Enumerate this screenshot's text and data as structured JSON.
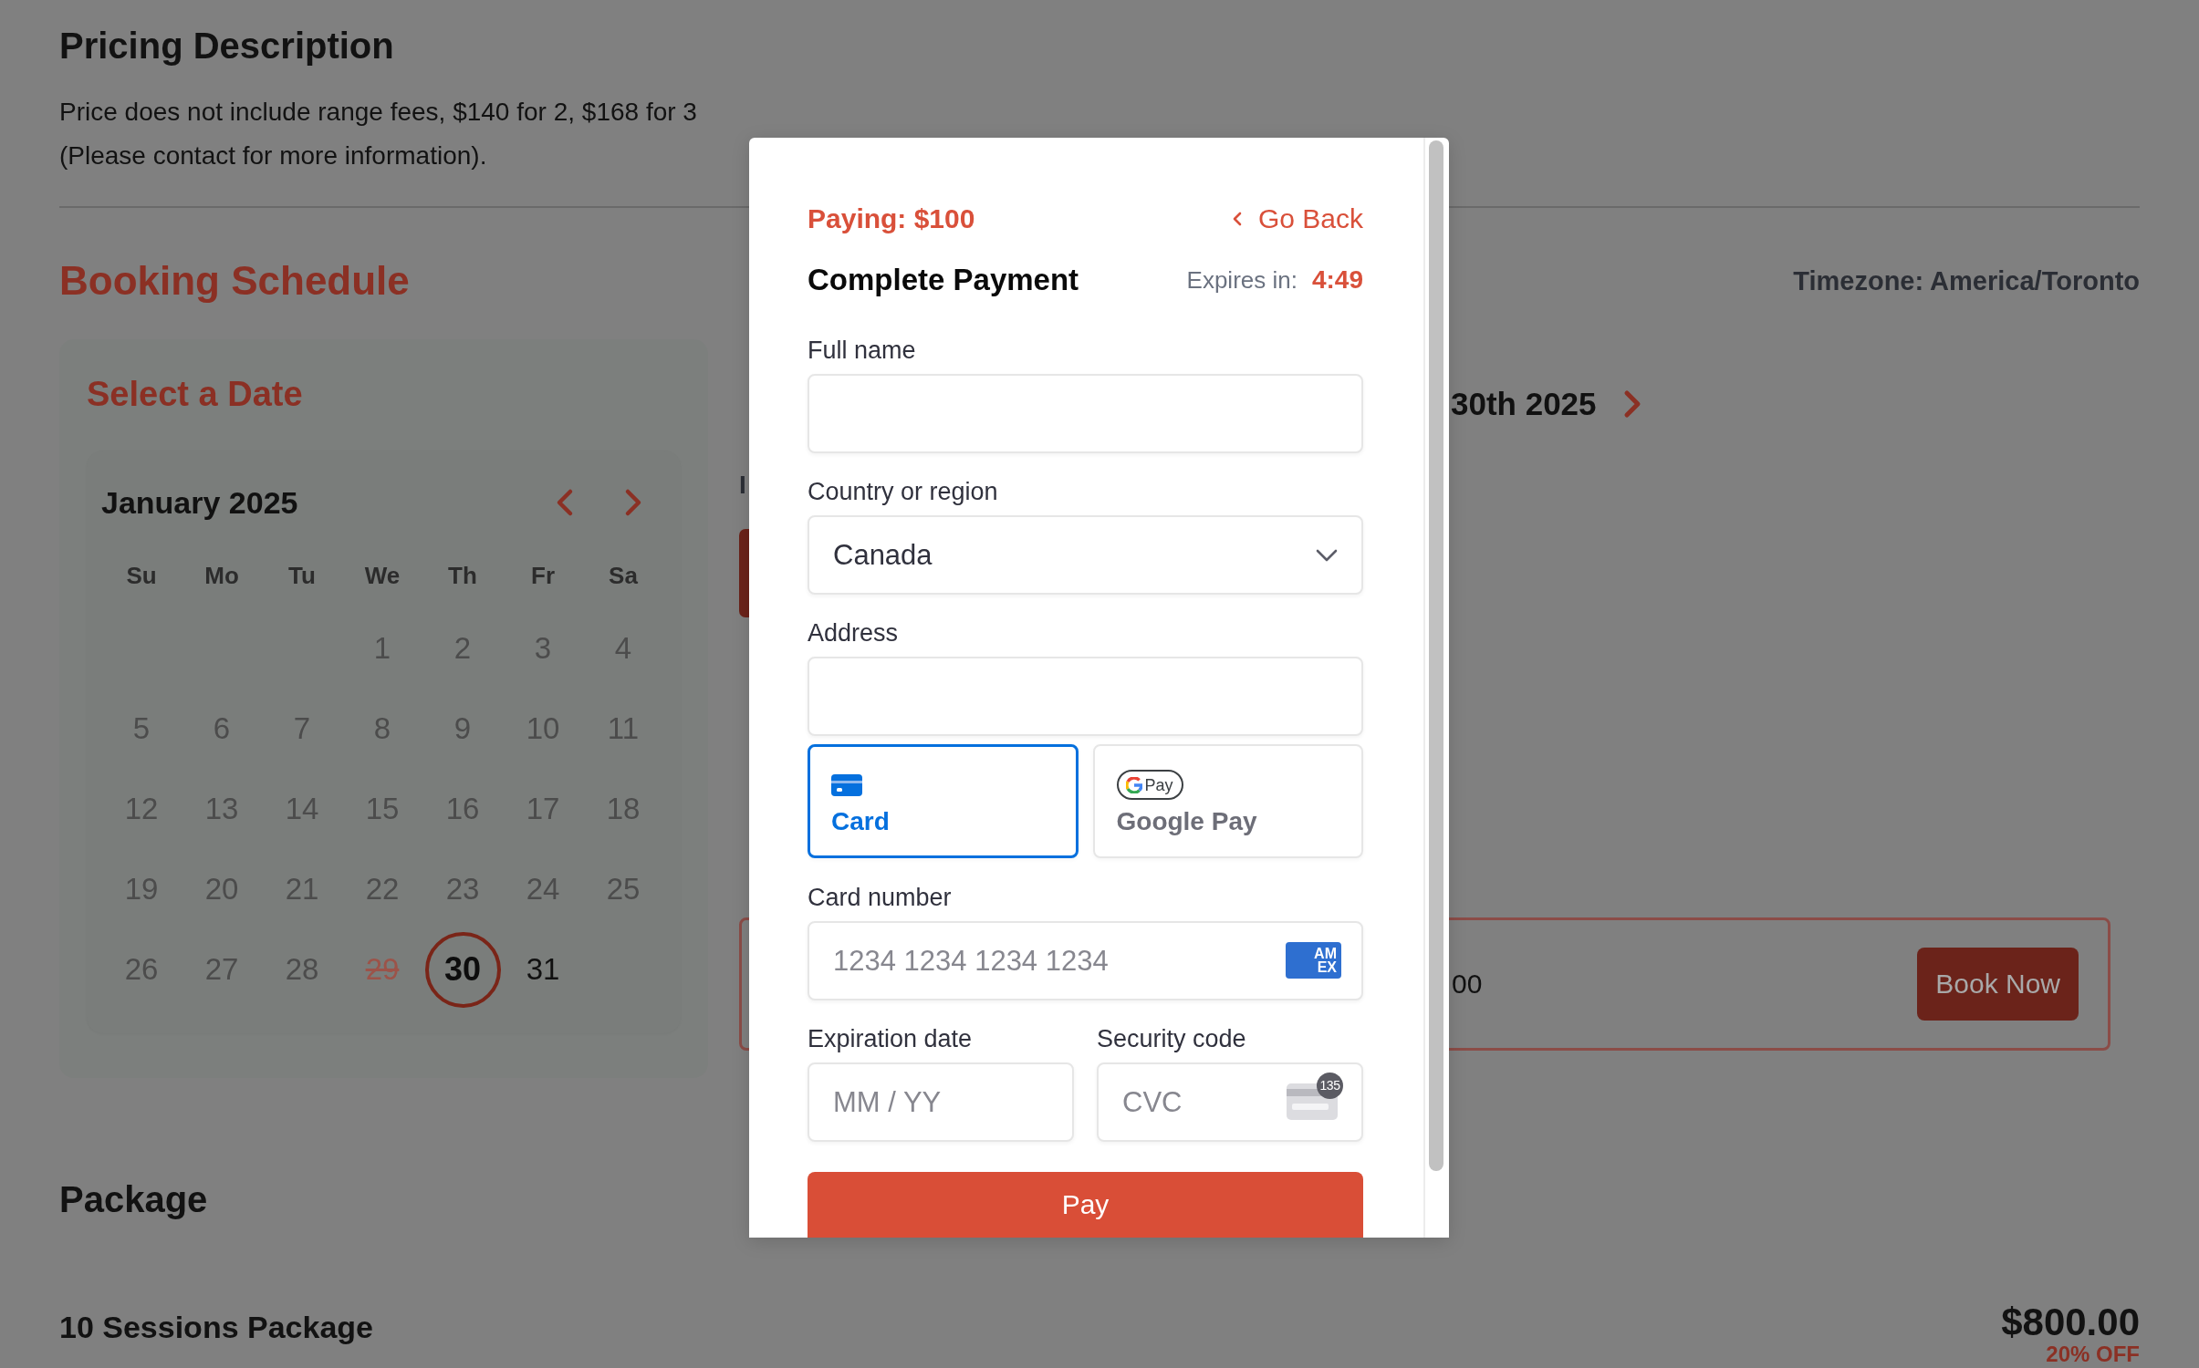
{
  "pricing": {
    "title": "Pricing Description",
    "lines": [
      "Price does not include range fees, $140 for 2, $168 for 3",
      "(Please contact for more information)."
    ]
  },
  "booking": {
    "title": "Booking Schedule",
    "timezone": "Timezone: America/Toronto",
    "date_picker": {
      "title": "Select a Date",
      "month": "January 2025",
      "weekdays": [
        "Su",
        "Mo",
        "Tu",
        "We",
        "Th",
        "Fr",
        "Sa"
      ],
      "weeks": [
        [
          {
            "label": "1",
            "kind": "past",
            "selected": false
          },
          {
            "label": "2",
            "kind": "past",
            "selected": false
          },
          {
            "label": "3",
            "kind": "past",
            "selected": false
          },
          {
            "label": "4",
            "kind": "past",
            "selected": false
          }
        ],
        [
          {
            "label": "5",
            "kind": "past",
            "selected": false
          },
          {
            "label": "6",
            "kind": "past",
            "selected": false
          },
          {
            "label": "7",
            "kind": "past",
            "selected": false
          },
          {
            "label": "8",
            "kind": "past",
            "selected": false
          },
          {
            "label": "9",
            "kind": "past",
            "selected": false
          },
          {
            "label": "10",
            "kind": "past",
            "selected": false
          },
          {
            "label": "11",
            "kind": "past",
            "selected": false
          }
        ],
        [
          {
            "label": "12",
            "kind": "past",
            "selected": false
          },
          {
            "label": "13",
            "kind": "past",
            "selected": false
          },
          {
            "label": "14",
            "kind": "past",
            "selected": false
          },
          {
            "label": "15",
            "kind": "past",
            "selected": false
          },
          {
            "label": "16",
            "kind": "past",
            "selected": false
          },
          {
            "label": "17",
            "kind": "past",
            "selected": false
          },
          {
            "label": "18",
            "kind": "past",
            "selected": false
          }
        ],
        [
          {
            "label": "19",
            "kind": "past",
            "selected": false
          },
          {
            "label": "20",
            "kind": "past",
            "selected": false
          },
          {
            "label": "21",
            "kind": "past",
            "selected": false
          },
          {
            "label": "22",
            "kind": "past",
            "selected": false
          },
          {
            "label": "23",
            "kind": "past",
            "selected": false
          },
          {
            "label": "24",
            "kind": "past",
            "selected": false
          },
          {
            "label": "25",
            "kind": "past",
            "selected": false
          }
        ],
        [
          {
            "label": "26",
            "kind": "past",
            "selected": false
          },
          {
            "label": "27",
            "kind": "past",
            "selected": false
          },
          {
            "label": "28",
            "kind": "past",
            "selected": false
          },
          {
            "label": "29",
            "kind": "booked",
            "selected": false
          },
          {
            "label": "30",
            "kind": "open",
            "selected": true
          },
          {
            "label": "31",
            "kind": "open",
            "selected": false
          }
        ]
      ]
    },
    "day_nav": {
      "label": "30th 2025"
    },
    "slots": {
      "heading": "I"
    },
    "summary": {
      "price": "00",
      "button": "Book Now"
    }
  },
  "package": {
    "title": "Package",
    "items": [
      {
        "name": "10 Sessions Package",
        "price": "$800.00",
        "discount": "20% OFF"
      }
    ]
  },
  "payment": {
    "amount": "Paying: $100",
    "back": "Go Back",
    "title": "Complete Payment",
    "expires_label": "Expires in:",
    "expires_value": "4:49",
    "billing_fields": [
      {
        "label": "Full name",
        "kind": "text"
      },
      {
        "label": "Country or region",
        "kind": "select",
        "value": "Canada"
      },
      {
        "label": "Address",
        "kind": "text"
      }
    ],
    "methods": [
      {
        "label": "Card",
        "kind": "card",
        "selected": true
      },
      {
        "label": "Google Pay",
        "kind": "gpay",
        "selected": false,
        "badge": "Pay"
      }
    ],
    "card_fields": [
      {
        "label": "Card number",
        "kind": "number",
        "placeholder": "1234 1234 1234 1234",
        "brand": [
          "AM",
          "EX"
        ]
      },
      {
        "label": "Expiration date",
        "kind": "expiry",
        "placeholder": "MM / YY"
      },
      {
        "label": "Security code",
        "kind": "cvc",
        "placeholder": "CVC",
        "badge": "135"
      }
    ],
    "button": "Pay"
  }
}
